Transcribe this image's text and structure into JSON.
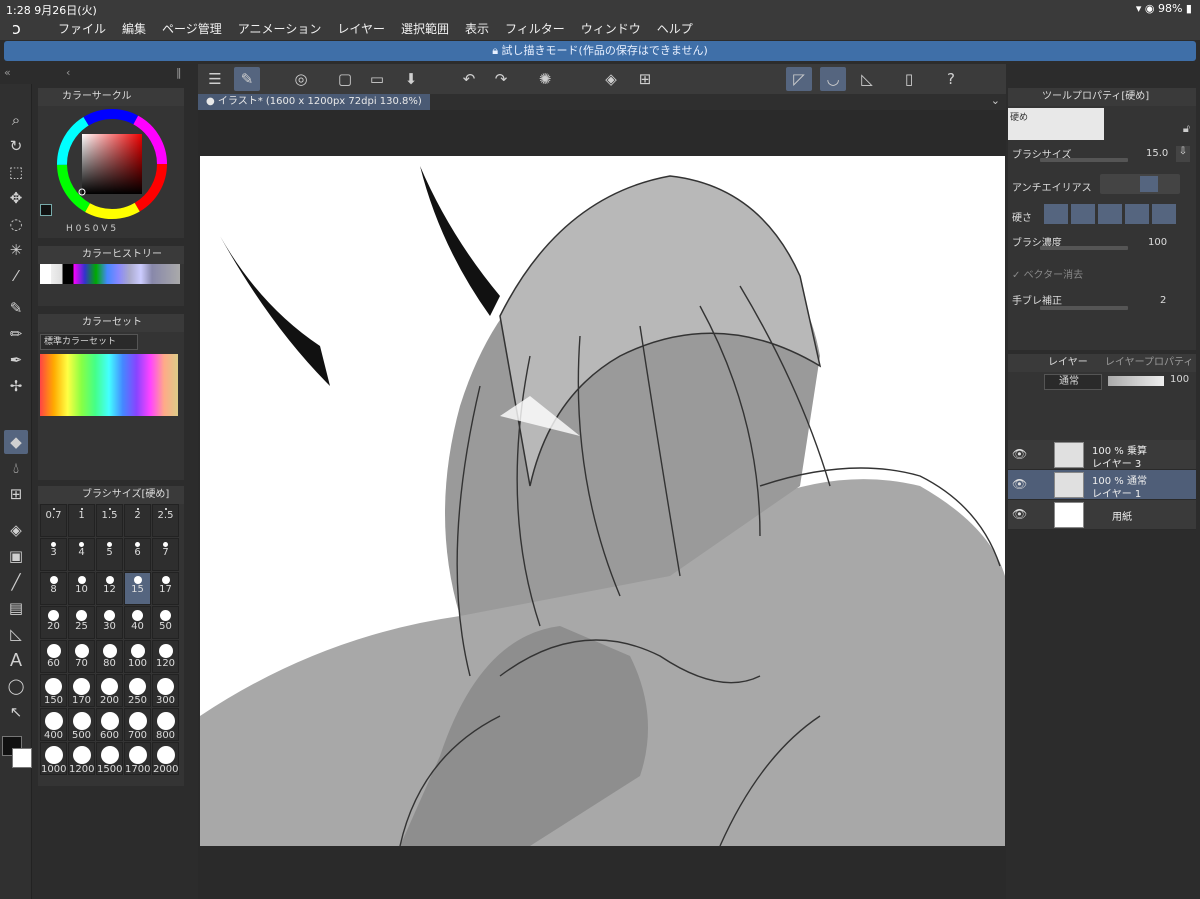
{
  "status": {
    "time_date": "1:28   9月26日(火)",
    "battery": "98%"
  },
  "menu": [
    "ファイル",
    "編集",
    "ページ管理",
    "アニメーション",
    "レイヤー",
    "選択範囲",
    "表示",
    "フィルター",
    "ウィンドウ",
    "ヘルプ"
  ],
  "banner": "試し描きモード(作品の保存はできません)",
  "doc_tab": "イラスト* (1600 x 1200px 72dpi 130.8%)",
  "color_circle": {
    "title": "カラーサークル",
    "hsv_label": "H 0 S 0 V 5"
  },
  "color_history": {
    "title": "カラーヒストリー"
  },
  "color_set": {
    "title": "カラーセット",
    "dropdown": "標準カラーセット"
  },
  "brush_size": {
    "title": "ブラシサイズ[硬め]",
    "sizes": [
      "0.7",
      "1",
      "1.5",
      "2",
      "2.5",
      "3",
      "4",
      "5",
      "6",
      "7",
      "8",
      "10",
      "12",
      "15",
      "17",
      "20",
      "25",
      "30",
      "40",
      "50",
      "60",
      "70",
      "80",
      "100",
      "120",
      "150",
      "170",
      "200",
      "250",
      "300",
      "400",
      "500",
      "600",
      "700",
      "800",
      "1000",
      "1200",
      "1500",
      "1700",
      "2000"
    ],
    "selected": "15"
  },
  "tool_property": {
    "title": "ツールプロパティ[硬め]",
    "brush_preview_label": "硬め",
    "brush_size_label": "ブラシサイズ",
    "brush_size_value": "15.0",
    "antialias_label": "アンチエイリアス",
    "hardness_label": "硬さ",
    "density_label": "ブラシ濃度",
    "density_value": "100",
    "vector_erase_label": "ベクター消去",
    "stabilizer_label": "手ブレ補正",
    "stabilizer_value": "2"
  },
  "layer_panel": {
    "tab1": "レイヤー",
    "tab2": "レイヤープロパティ",
    "blend_mode": "通常",
    "opacity": "100",
    "layers": [
      {
        "line1": "100 % 乗算",
        "line2": "レイヤー 3",
        "selected": false
      },
      {
        "line1": "100 % 通常",
        "line2": "レイヤー 1",
        "selected": true
      },
      {
        "line1": "",
        "line2": "用紙",
        "selected": false
      }
    ]
  },
  "colors": {
    "accent": "#55657f",
    "banner": "#3f6fa8",
    "panel": "#343434"
  }
}
